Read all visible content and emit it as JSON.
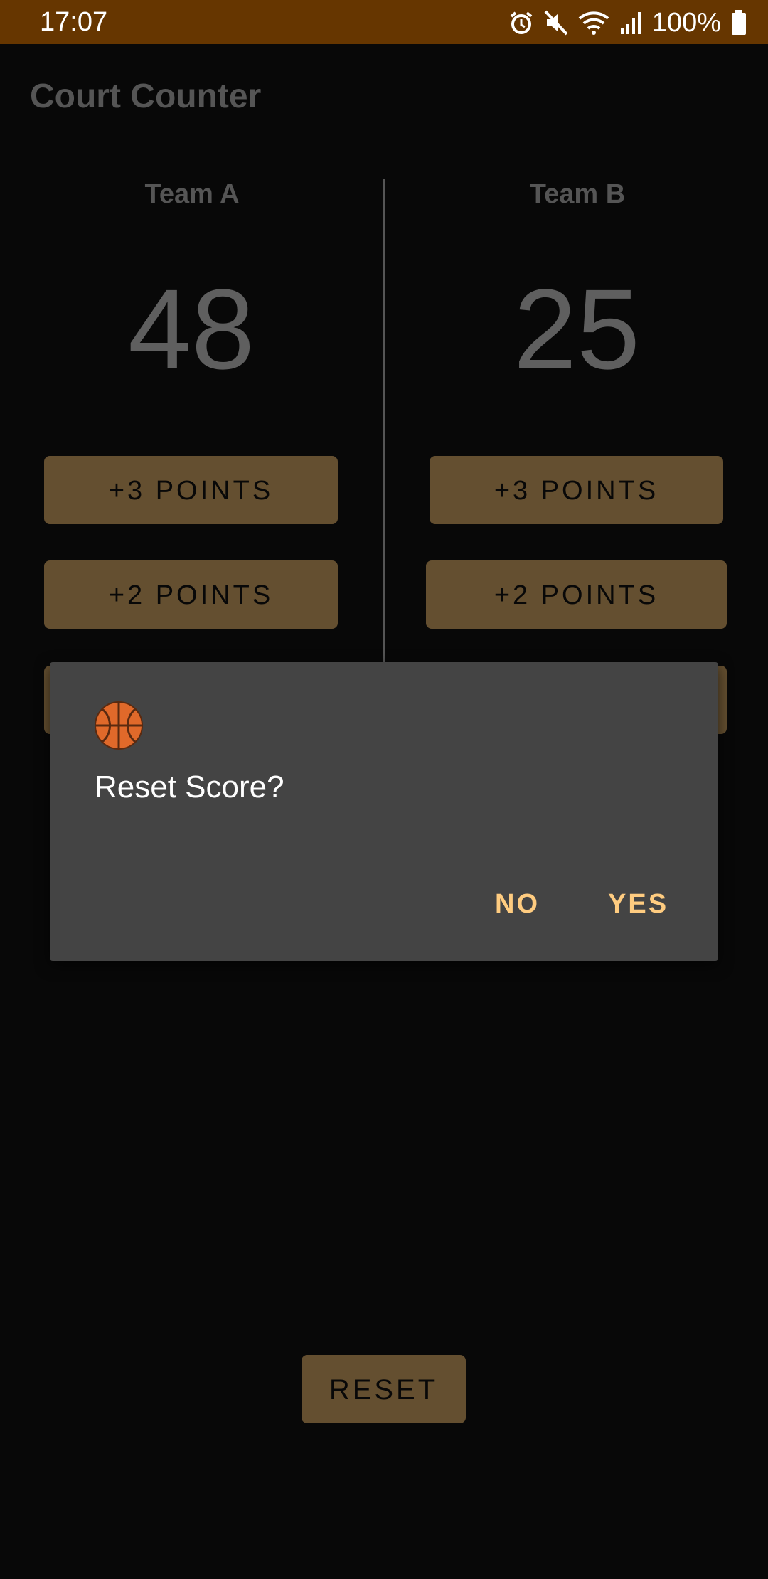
{
  "status_bar": {
    "time": "17:07",
    "battery_percent": "100%",
    "icons": [
      "alarm-icon",
      "mute-icon",
      "wifi-icon",
      "signal-icon",
      "battery-icon"
    ]
  },
  "app": {
    "title": "Court Counter"
  },
  "team_a": {
    "name": "Team A",
    "score": "48",
    "btn_three": "+3 POINTS",
    "btn_two": "+2 POINTS"
  },
  "team_b": {
    "name": "Team B",
    "score": "25",
    "btn_three": "+3 POINTS",
    "btn_two": "+2 POINTS"
  },
  "reset_button": "RESET",
  "dialog": {
    "icon": "basketball-icon",
    "title": "Reset Score?",
    "no_label": "NO",
    "yes_label": "YES"
  },
  "colors": {
    "status_bar": "#663600",
    "background": "#080808",
    "button": "#644f30",
    "dialog": "#444444",
    "dialog_action": "#ffcc80"
  }
}
